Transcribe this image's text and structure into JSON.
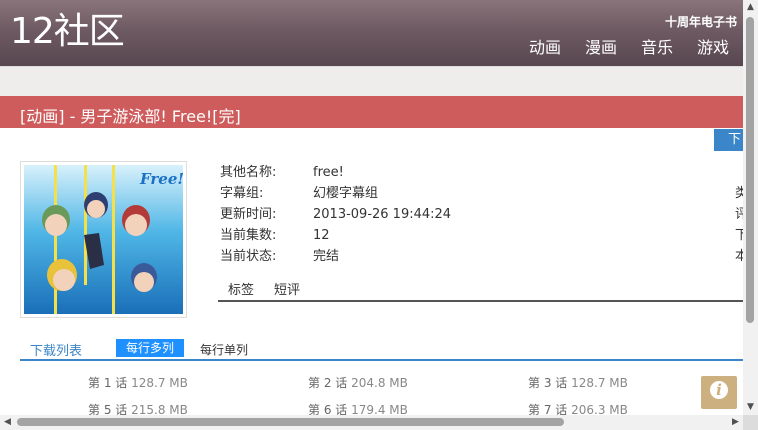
{
  "header": {
    "logo": "12社区",
    "top_link": "十周年电子书",
    "nav": [
      "动画",
      "漫画",
      "音乐",
      "游戏"
    ]
  },
  "title": "[动画] - 男子游泳部! Free![完]",
  "download_button": "下",
  "cover": {
    "logo_text": "Free!"
  },
  "info": [
    {
      "label": "其他名称:",
      "value": "free!"
    },
    {
      "label": "字幕组:",
      "value": "幻樱字幕组"
    },
    {
      "label": "更新时间:",
      "value": "2013-09-26 19:44:24"
    },
    {
      "label": "当前集数:",
      "value": "12"
    },
    {
      "label": "当前状态:",
      "value": "完结"
    }
  ],
  "right_column": [
    "类",
    "评",
    "下",
    "本"
  ],
  "tabs": [
    "标签",
    "短评"
  ],
  "download_list": {
    "title": "下载列表",
    "mode_multi": "每行多列",
    "mode_single": "每行单列"
  },
  "episodes": [
    {
      "label": "第 1 话",
      "size": "128.7 MB"
    },
    {
      "label": "第 2 话",
      "size": "204.8 MB"
    },
    {
      "label": "第 3 话",
      "size": "128.7 MB"
    },
    {
      "label": "第 5 话",
      "size": "215.8 MB"
    },
    {
      "label": "第 6 话",
      "size": "179.4 MB"
    },
    {
      "label": "第 7 话",
      "size": "206.3 MB"
    }
  ],
  "info_icon": "i",
  "colors": {
    "header": "#6e5a62",
    "title_bar": "#cf5c5c",
    "accent_blue": "#1e90ff",
    "info_icon": "#cdb080"
  },
  "icons": {
    "info": "info-icon",
    "scroll_up": "arrow-up-icon",
    "scroll_down": "arrow-down-icon",
    "scroll_left": "arrow-left-icon",
    "scroll_right": "arrow-right-icon"
  }
}
